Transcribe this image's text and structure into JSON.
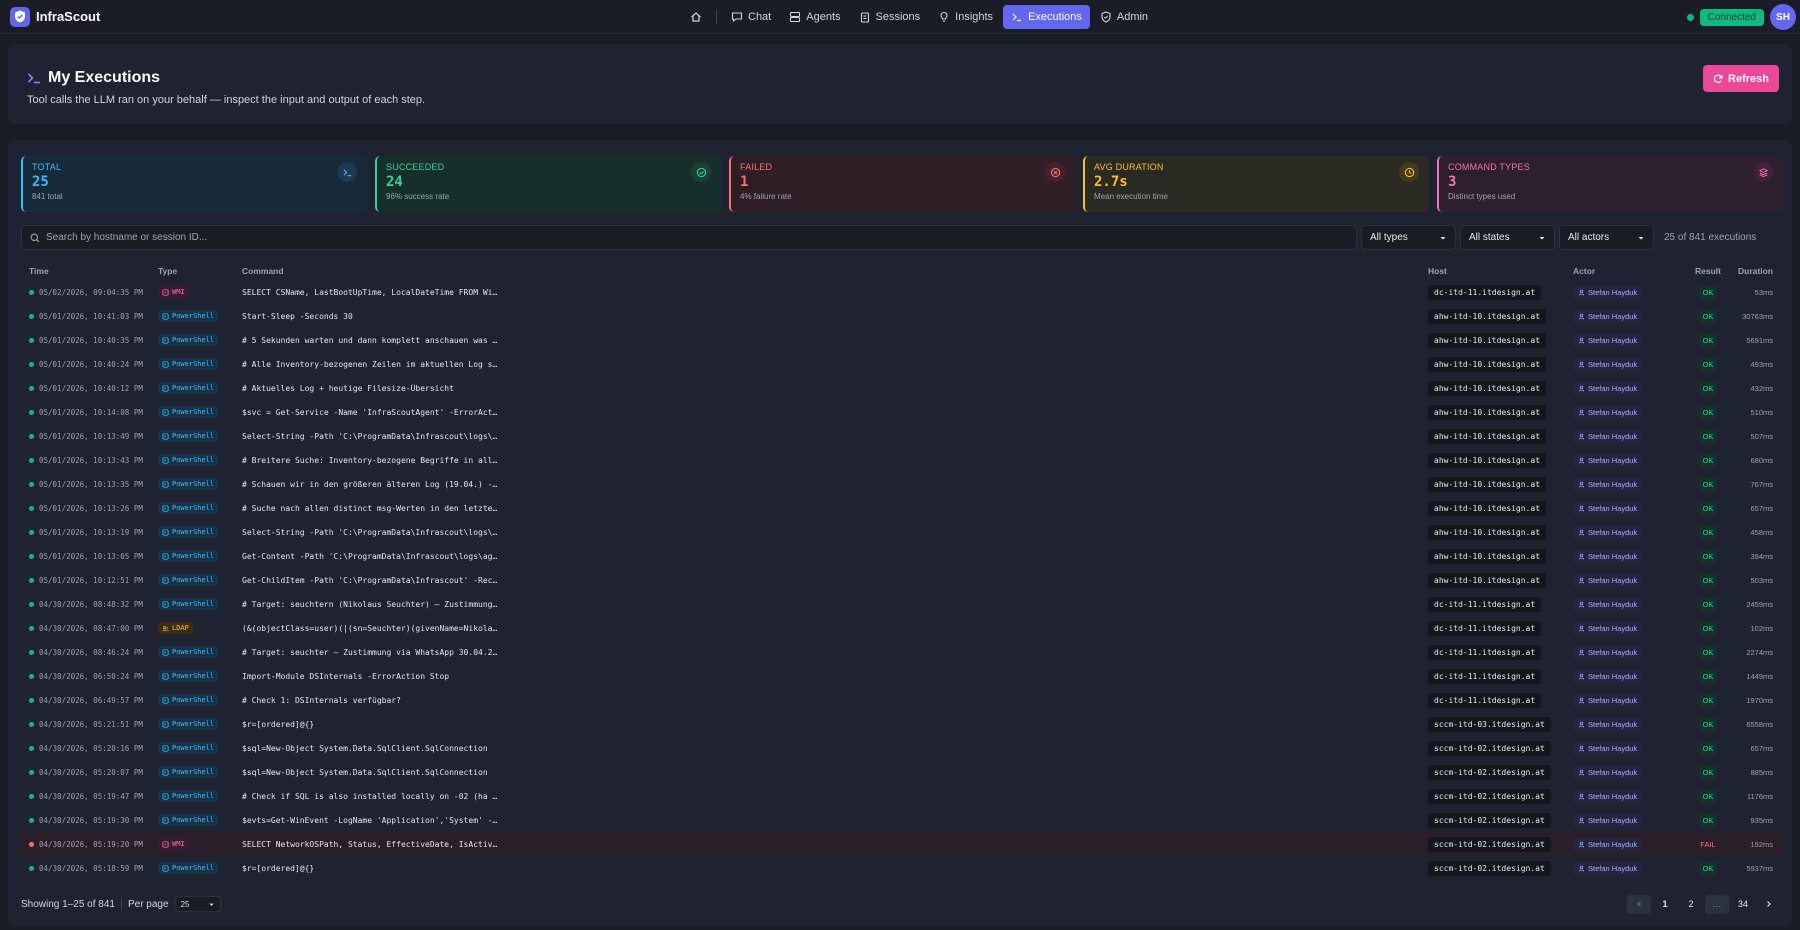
{
  "app": {
    "name": "InfraScout"
  },
  "nav": {
    "home_icon": "home-icon",
    "items": [
      {
        "label": "Chat",
        "icon": "chat-icon"
      },
      {
        "label": "Agents",
        "icon": "agents-icon"
      },
      {
        "label": "Sessions",
        "icon": "clipboard-icon"
      },
      {
        "label": "Insights",
        "icon": "bulb-icon"
      },
      {
        "label": "Executions",
        "icon": "terminal-icon",
        "active": true
      },
      {
        "label": "Admin",
        "icon": "shield-icon"
      }
    ]
  },
  "status": {
    "connection": "Connected",
    "avatar_initials": "SH"
  },
  "page": {
    "title": "My Executions",
    "subtitle": "Tool calls the LLM ran on your behalf — inspect the input and output of each step.",
    "refresh_label": "Refresh"
  },
  "stats": [
    {
      "label": "TOTAL",
      "value": "25",
      "sub": "841 total",
      "color": "#38bdf8",
      "icon": "terminal-icon"
    },
    {
      "label": "SUCCEEDED",
      "value": "24",
      "sub": "96% success rate",
      "color": "#34d399",
      "icon": "check-circle-icon"
    },
    {
      "label": "FAILED",
      "value": "1",
      "sub": "4% failure rate",
      "color": "#f87171",
      "icon": "x-circle-icon"
    },
    {
      "label": "AVG DURATION",
      "value": "2.7s",
      "sub": "Mean execution time",
      "color": "#fbbf24",
      "icon": "clock-icon"
    },
    {
      "label": "COMMAND TYPES",
      "value": "3",
      "sub": "Distinct types used",
      "color": "#f472b6",
      "icon": "layers-icon"
    }
  ],
  "filters": {
    "search_placeholder": "Search by hostname or session ID...",
    "type": "All types",
    "state": "All states",
    "actor": "All actors",
    "count_text": "25 of 841 executions"
  },
  "table": {
    "columns": {
      "time": "Time",
      "type": "Type",
      "command": "Command",
      "host": "Host",
      "actor": "Actor",
      "result": "Result",
      "duration": "Duration"
    },
    "rows": [
      {
        "time": "05/02/2026, 09:04:35 PM",
        "type": "WMI",
        "command": "SELECT CSName, LastBootUpTime, LocalDateTime FROM Wi…",
        "host": "dc-itd-11.itdesign.at",
        "actor": "Stefan Hayduk",
        "result": "OK",
        "duration": "53ms"
      },
      {
        "time": "05/01/2026, 10:41:03 PM",
        "type": "PowerShell",
        "command": "Start-Sleep -Seconds 30",
        "host": "ahw-itd-10.itdesign.at",
        "actor": "Stefan Hayduk",
        "result": "OK",
        "duration": "30763ms"
      },
      {
        "time": "05/01/2026, 10:40:35 PM",
        "type": "PowerShell",
        "command": "# 5 Sekunden warten und dann komplett anschauen was …",
        "host": "ahw-itd-10.itdesign.at",
        "actor": "Stefan Hayduk",
        "result": "OK",
        "duration": "5691ms"
      },
      {
        "time": "05/01/2026, 10:40:24 PM",
        "type": "PowerShell",
        "command": "# Alle Inventory-bezogenen Zeilen im aktuellen Log s…",
        "host": "ahw-itd-10.itdesign.at",
        "actor": "Stefan Hayduk",
        "result": "OK",
        "duration": "493ms"
      },
      {
        "time": "05/01/2026, 10:40:12 PM",
        "type": "PowerShell",
        "command": "# Aktuelles Log + heutige Filesize-Übersicht",
        "host": "ahw-itd-10.itdesign.at",
        "actor": "Stefan Hayduk",
        "result": "OK",
        "duration": "432ms"
      },
      {
        "time": "05/01/2026, 10:14:08 PM",
        "type": "PowerShell",
        "command": "$svc = Get-Service -Name 'InfraScoutAgent' -ErrorAct…",
        "host": "ahw-itd-10.itdesign.at",
        "actor": "Stefan Hayduk",
        "result": "OK",
        "duration": "510ms"
      },
      {
        "time": "05/01/2026, 10:13:49 PM",
        "type": "PowerShell",
        "command": "Select-String -Path 'C:\\ProgramData\\Infrascout\\logs\\…",
        "host": "ahw-itd-10.itdesign.at",
        "actor": "Stefan Hayduk",
        "result": "OK",
        "duration": "507ms"
      },
      {
        "time": "05/01/2026, 10:13:43 PM",
        "type": "PowerShell",
        "command": "# Breitere Suche: Inventory-bezogene Begriffe in all…",
        "host": "ahw-itd-10.itdesign.at",
        "actor": "Stefan Hayduk",
        "result": "OK",
        "duration": "680ms"
      },
      {
        "time": "05/01/2026, 10:13:35 PM",
        "type": "PowerShell",
        "command": "# Schauen wir in den größeren älteren Log (19.04.) -…",
        "host": "ahw-itd-10.itdesign.at",
        "actor": "Stefan Hayduk",
        "result": "OK",
        "duration": "767ms"
      },
      {
        "time": "05/01/2026, 10:13:26 PM",
        "type": "PowerShell",
        "command": "# Suche nach allen distinct msg-Werten in den letzte…",
        "host": "ahw-itd-10.itdesign.at",
        "actor": "Stefan Hayduk",
        "result": "OK",
        "duration": "657ms"
      },
      {
        "time": "05/01/2026, 10:13:19 PM",
        "type": "PowerShell",
        "command": "Select-String -Path 'C:\\ProgramData\\Infrascout\\logs\\…",
        "host": "ahw-itd-10.itdesign.at",
        "actor": "Stefan Hayduk",
        "result": "OK",
        "duration": "458ms"
      },
      {
        "time": "05/01/2026, 10:13:05 PM",
        "type": "PowerShell",
        "command": "Get-Content -Path 'C:\\ProgramData\\Infrascout\\logs\\ag…",
        "host": "ahw-itd-10.itdesign.at",
        "actor": "Stefan Hayduk",
        "result": "OK",
        "duration": "394ms"
      },
      {
        "time": "05/01/2026, 10:12:51 PM",
        "type": "PowerShell",
        "command": "Get-ChildItem -Path 'C:\\ProgramData\\Infrascout' -Rec…",
        "host": "ahw-itd-10.itdesign.at",
        "actor": "Stefan Hayduk",
        "result": "OK",
        "duration": "503ms"
      },
      {
        "time": "04/30/2026, 08:48:32 PM",
        "type": "PowerShell",
        "command": "# Target: seuchtern (Nikolaus Seuchter) — Zustimmung…",
        "host": "dc-itd-11.itdesign.at",
        "actor": "Stefan Hayduk",
        "result": "OK",
        "duration": "2459ms"
      },
      {
        "time": "04/30/2026, 08:47:00 PM",
        "type": "LDAP",
        "command": "(&(objectClass=user)(|(sn=Seuchter)(givenName=Nikola…",
        "host": "dc-itd-11.itdesign.at",
        "actor": "Stefan Hayduk",
        "result": "OK",
        "duration": "102ms"
      },
      {
        "time": "04/30/2026, 08:46:24 PM",
        "type": "PowerShell",
        "command": "# Target: seuchter — Zustimmung via WhatsApp 30.04.2…",
        "host": "dc-itd-11.itdesign.at",
        "actor": "Stefan Hayduk",
        "result": "OK",
        "duration": "2274ms"
      },
      {
        "time": "04/30/2026, 06:50:24 PM",
        "type": "PowerShell",
        "command": "Import-Module DSInternals -ErrorAction Stop",
        "host": "dc-itd-11.itdesign.at",
        "actor": "Stefan Hayduk",
        "result": "OK",
        "duration": "1449ms"
      },
      {
        "time": "04/30/2026, 06:49:57 PM",
        "type": "PowerShell",
        "command": "# Check 1: DSInternals verfügbar?",
        "host": "dc-itd-11.itdesign.at",
        "actor": "Stefan Hayduk",
        "result": "OK",
        "duration": "1970ms"
      },
      {
        "time": "04/30/2026, 05:21:51 PM",
        "type": "PowerShell",
        "command": "$r=[ordered]@{}",
        "host": "sccm-itd-03.itdesign.at",
        "actor": "Stefan Hayduk",
        "result": "OK",
        "duration": "6558ms"
      },
      {
        "time": "04/30/2026, 05:20:16 PM",
        "type": "PowerShell",
        "command": "$sql=New-Object System.Data.SqlClient.SqlConnection",
        "host": "sccm-itd-02.itdesign.at",
        "actor": "Stefan Hayduk",
        "result": "OK",
        "duration": "657ms"
      },
      {
        "time": "04/30/2026, 05:20:07 PM",
        "type": "PowerShell",
        "command": "$sql=New-Object System.Data.SqlClient.SqlConnection",
        "host": "sccm-itd-02.itdesign.at",
        "actor": "Stefan Hayduk",
        "result": "OK",
        "duration": "885ms"
      },
      {
        "time": "04/30/2026, 05:19:47 PM",
        "type": "PowerShell",
        "command": "# Check if SQL is also installed locally on -02 (ha …",
        "host": "sccm-itd-02.itdesign.at",
        "actor": "Stefan Hayduk",
        "result": "OK",
        "duration": "1176ms"
      },
      {
        "time": "04/30/2026, 05:19:30 PM",
        "type": "PowerShell",
        "command": "$evts=Get-WinEvent -LogName 'Application','System' -…",
        "host": "sccm-itd-02.itdesign.at",
        "actor": "Stefan Hayduk",
        "result": "OK",
        "duration": "935ms"
      },
      {
        "time": "04/30/2026, 05:19:20 PM",
        "type": "WMI",
        "command": "SELECT NetworkOSPath, Status, EffectiveDate, IsActiv…",
        "host": "sccm-itd-02.itdesign.at",
        "actor": "Stefan Hayduk",
        "result": "FAIL",
        "duration": "192ms"
      },
      {
        "time": "04/30/2026, 05:18:59 PM",
        "type": "PowerShell",
        "command": "$r=[ordered]@{}",
        "host": "sccm-itd-02.itdesign.at",
        "actor": "Stefan Hayduk",
        "result": "OK",
        "duration": "5937ms"
      }
    ]
  },
  "footer": {
    "showing": "Showing 1–25 of 841",
    "per_page_label": "Per page",
    "per_page_value": "25",
    "pages": [
      "1",
      "2",
      "…",
      "34"
    ]
  },
  "colors": {
    "accent": "#6366f1",
    "ok": "#10b981",
    "fail": "#f87171",
    "refresh": "#ec4899"
  }
}
